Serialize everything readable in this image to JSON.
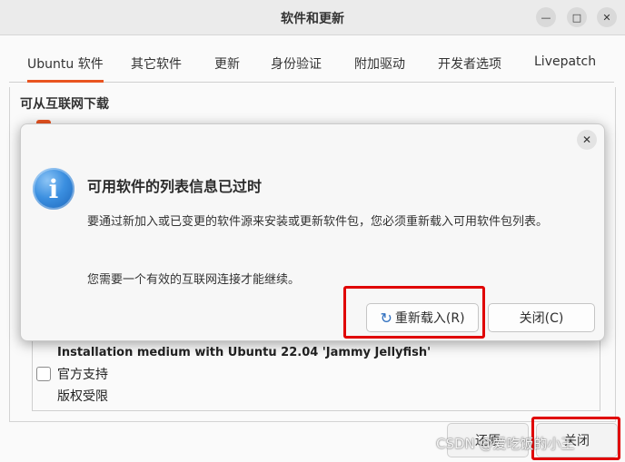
{
  "window": {
    "title": "软件和更新",
    "minimize_icon": "minimize-icon",
    "maximize_icon": "maximize-icon",
    "close_icon": "close-icon"
  },
  "tabs": [
    {
      "label": "Ubuntu 软件",
      "active": true
    },
    {
      "label": "其它软件"
    },
    {
      "label": "更新"
    },
    {
      "label": "身份验证"
    },
    {
      "label": "附加驱动"
    },
    {
      "label": "开发者选项"
    },
    {
      "label": "Livepatch"
    }
  ],
  "main": {
    "section_title": "可从互联网下载",
    "source": {
      "title": "Installation medium with Ubuntu 22.04 'Jammy Jellyfish'",
      "line1": "官方支持",
      "line2": "版权受限"
    },
    "bottom_left_button": "还原",
    "bottom_right_button": "关闭"
  },
  "dialog": {
    "title": "可用软件的列表信息已过时",
    "message": "要通过新加入或已变更的软件源来安装或更新软件包，您必须重新载入可用软件包列表。",
    "message2": "您需要一个有效的互联网连接才能继续。",
    "reload_button": "重新载入(R)",
    "close_button": "关闭(C)",
    "icon": "info-icon"
  },
  "watermark": "CSDN @爱吃饭的小王",
  "colors": {
    "accent": "#e95420",
    "highlight_box": "#e00000",
    "info_blue": "#3b8fe0"
  }
}
